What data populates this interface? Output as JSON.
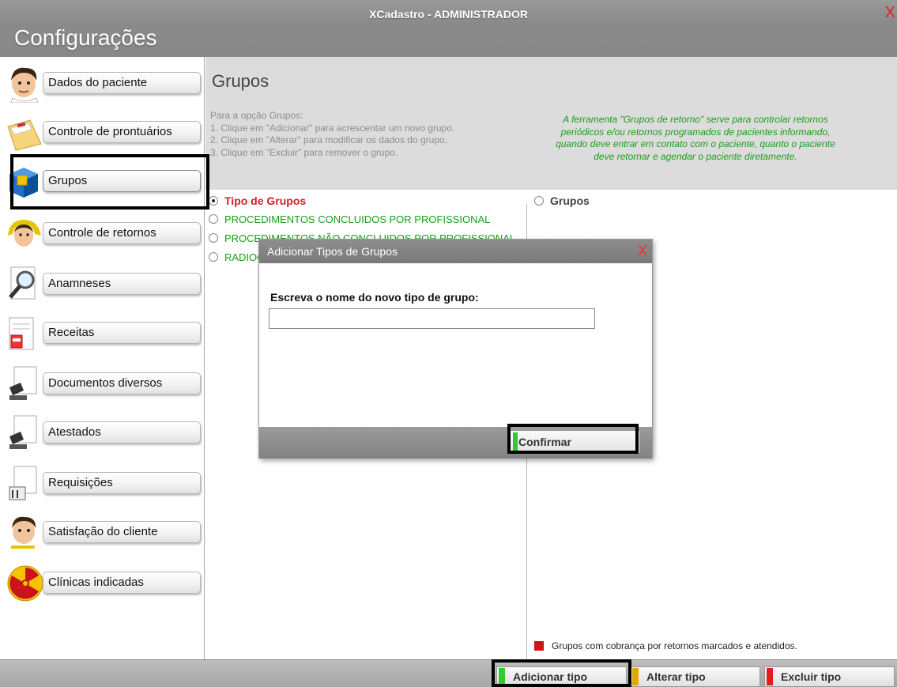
{
  "window": {
    "title": "XCadastro - ADMINISTRADOR",
    "close_glyph": "X",
    "section_title": "Configurações"
  },
  "sidebar": {
    "items": [
      {
        "label": "Dados do paciente",
        "icon": "doctor-face-icon"
      },
      {
        "label": "Controle de prontuários",
        "icon": "folder-icon"
      },
      {
        "label": "Grupos",
        "icon": "cube-icon",
        "selected": true
      },
      {
        "label": "Controle de retornos",
        "icon": "doctor-return-icon"
      },
      {
        "label": "Anamneses",
        "icon": "magnifier-icon"
      },
      {
        "label": "Receitas",
        "icon": "prescription-icon"
      },
      {
        "label": "Documentos diversos",
        "icon": "stamp-icon"
      },
      {
        "label": "Atestados",
        "icon": "stamp-icon"
      },
      {
        "label": "Requisições",
        "icon": "requisition-icon"
      },
      {
        "label": "Satisfação do cliente",
        "icon": "doctor-face-icon"
      },
      {
        "label": "Clínicas indicadas",
        "icon": "radiation-icon"
      }
    ]
  },
  "main": {
    "title": "Grupos",
    "instructions": [
      "Para a opção Grupos:",
      "1. Clique em \"Adicionar\" para acrescentar um novo grupo.",
      "2. Clique em \"Alterar\" para modificar os dados do grupo.",
      "3. Clique em \"Excluir\" para remover o grupo."
    ],
    "info_lines": [
      "A ferramenta \"Grupos de retorno\" serve para controlar retornos",
      "periódicos e/ou retornos programados de pacientes informando,",
      "quando deve entrar em contato com o paciente, quanto o paciente",
      "deve retornar e agendar o paciente diretamente."
    ],
    "left_header": "Tipo de Grupos",
    "types": [
      "PROCEDIMENTOS CONCLUIDOS POR PROFISSIONAL",
      "PROCEDIMENTOS NÃO CONCLUIDOS POR PROFISSIONAL",
      "RADIOGRAFIAS"
    ],
    "right_header": "Grupos",
    "legend": "Grupos com cobrança por retornos marcados e atendidos.",
    "legend_color": "#d01515"
  },
  "footer": {
    "add_label": "Adicionar tipo",
    "edit_label": "Alterar tipo",
    "delete_label": "Excluir tipo",
    "colors": {
      "add": "#2ecc2e",
      "edit": "#e0a800",
      "delete": "#e02020"
    }
  },
  "modal": {
    "title": "Adicionar Tipos de Grupos",
    "close_glyph": "X",
    "label": "Escreva o nome do novo tipo de grupo:",
    "input_value": "",
    "confirm_label": "Confirmar"
  }
}
